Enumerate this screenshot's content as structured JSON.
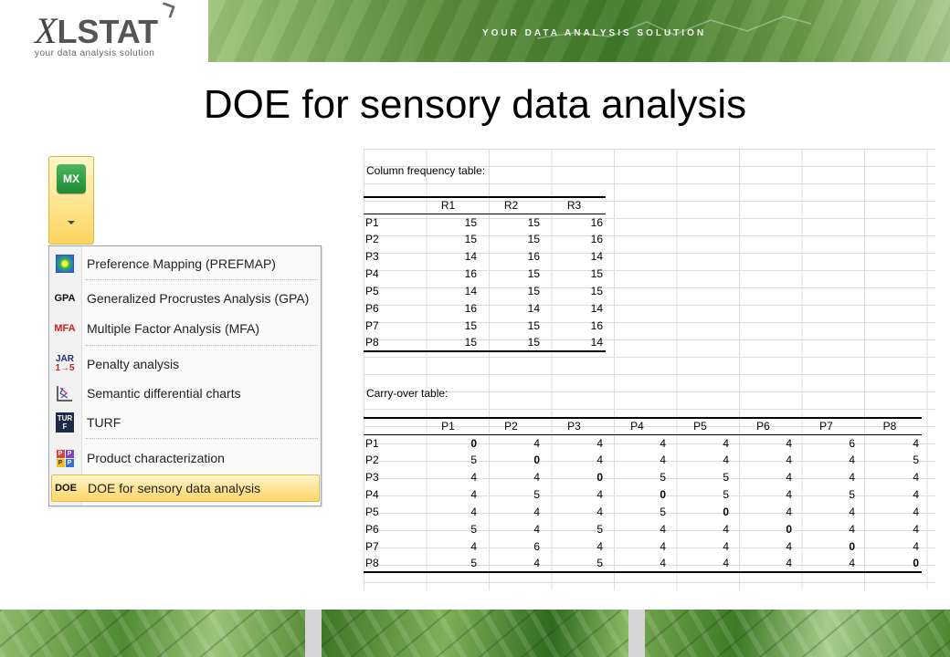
{
  "header": {
    "logo_x": "X",
    "logo_rest": "LSTAT",
    "logo_tagline": "your data analysis solution",
    "banner_text": "YOUR DATA ANALYSIS SOLUTION"
  },
  "title": "DOE for sensory data analysis",
  "ribbon": {
    "button_label": "MX"
  },
  "menu": {
    "items": [
      {
        "label": "Preference Mapping (PREFMAP)",
        "icon": "prefmap-icon"
      },
      {
        "label": "Generalized Procrustes Analysis (GPA)",
        "icon": "gpa-icon",
        "icon_text": "GPA"
      },
      {
        "label": "Multiple Factor Analysis (MFA)",
        "icon": "mfa-icon",
        "icon_text": "MFA"
      },
      {
        "label": "Penalty analysis",
        "icon": "jar-icon",
        "icon_text_top": "JAR",
        "icon_text_bottom": "1→5"
      },
      {
        "label": "Semantic differential charts",
        "icon": "semantic-chart-icon"
      },
      {
        "label": "TURF",
        "icon": "turf-icon",
        "icon_text": "TUR F"
      },
      {
        "label": "Product characterization",
        "icon": "product-icon",
        "icon_letters": [
          "P",
          "P",
          "P",
          "P"
        ]
      },
      {
        "label": "DOE for sensory data analysis",
        "icon": "doe-icon",
        "icon_text": "DOE",
        "selected": true
      }
    ]
  },
  "sheet": {
    "col_freq_title": "Column frequency table:",
    "col_freq": {
      "headers": [
        "",
        "R1",
        "R2",
        "R3"
      ],
      "rows": [
        [
          "P1",
          "15",
          "15",
          "16"
        ],
        [
          "P2",
          "15",
          "15",
          "16"
        ],
        [
          "P3",
          "14",
          "16",
          "14"
        ],
        [
          "P4",
          "16",
          "15",
          "15"
        ],
        [
          "P5",
          "14",
          "15",
          "15"
        ],
        [
          "P6",
          "16",
          "14",
          "14"
        ],
        [
          "P7",
          "15",
          "15",
          "16"
        ],
        [
          "P8",
          "15",
          "15",
          "14"
        ]
      ]
    },
    "carry_title": "Carry-over table:",
    "carry": {
      "headers": [
        "",
        "P1",
        "P2",
        "P3",
        "P4",
        "P5",
        "P6",
        "P7",
        "P8"
      ],
      "rows": [
        [
          "P1",
          "0",
          "4",
          "4",
          "4",
          "4",
          "4",
          "6",
          "4"
        ],
        [
          "P2",
          "5",
          "0",
          "4",
          "4",
          "4",
          "4",
          "4",
          "5"
        ],
        [
          "P3",
          "4",
          "4",
          "0",
          "5",
          "5",
          "4",
          "4",
          "4"
        ],
        [
          "P4",
          "4",
          "5",
          "4",
          "0",
          "5",
          "4",
          "5",
          "4"
        ],
        [
          "P5",
          "4",
          "4",
          "4",
          "5",
          "0",
          "4",
          "4",
          "4"
        ],
        [
          "P6",
          "5",
          "4",
          "5",
          "4",
          "4",
          "0",
          "4",
          "4"
        ],
        [
          "P7",
          "4",
          "6",
          "4",
          "4",
          "4",
          "4",
          "0",
          "4"
        ],
        [
          "P8",
          "5",
          "4",
          "5",
          "4",
          "4",
          "4",
          "4",
          "0"
        ]
      ]
    }
  }
}
